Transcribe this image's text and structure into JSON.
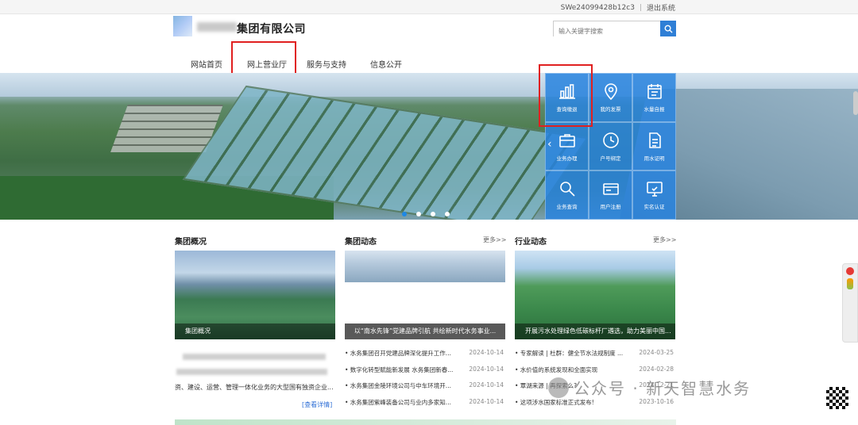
{
  "topbar": {
    "user": "SWe24099428b12c3",
    "separator": "|",
    "logout": "退出系统"
  },
  "header": {
    "company_suffix": "集团有限公司"
  },
  "search": {
    "placeholder": "输入关键字搜索"
  },
  "nav": [
    "网站首页",
    "网上营业厅",
    "服务与支持",
    "信息公开"
  ],
  "tiles": [
    {
      "label": "查询缴退",
      "icon": "bar-chart-icon"
    },
    {
      "label": "我的发票",
      "icon": "location-icon"
    },
    {
      "label": "水量自报",
      "icon": "calendar-icon"
    },
    {
      "label": "业务办理",
      "icon": "briefcase-icon"
    },
    {
      "label": "户号绑定",
      "icon": "clock-icon"
    },
    {
      "label": "用水证明",
      "icon": "document-icon"
    },
    {
      "label": "业务查询",
      "icon": "search-icon"
    },
    {
      "label": "用户注册",
      "icon": "id-card-icon"
    },
    {
      "label": "实名认证",
      "icon": "monitor-icon"
    }
  ],
  "sections": {
    "overview": {
      "title": "集团概况",
      "caption": "集团概况",
      "intro_line": "资、建设、运营、管理一体化业务的大型国有独资企业...",
      "more": "[查看详情]"
    },
    "group_news": {
      "title": "集团动态",
      "more": "更多>>",
      "caption": "以“南水先锋”党建品牌引航 共绘新时代水务事业...",
      "items": [
        {
          "title": "• 水务集团召开党建品牌深化提升工作...",
          "date": "2024-10-14"
        },
        {
          "title": "• 数字化转型赋能新发展 水务集团新春...",
          "date": "2024-10-14"
        },
        {
          "title": "• 水务集团金陵环境公司与中车环境开...",
          "date": "2024-10-14"
        },
        {
          "title": "• 水务集团紫峰装备公司与业内多家知...",
          "date": "2024-10-14"
        }
      ]
    },
    "industry_news": {
      "title": "行业动态",
      "more": "更多>>",
      "caption": "开展污水处理绿色低碳标杆厂遴选，助力美丽中国...",
      "items": [
        {
          "title": "• 专家解读 | 杜群：健全节水法规制度 ...",
          "date": "2024-03-25"
        },
        {
          "title": "• 水价值的系统发现和全面实现",
          "date": "2024-02-28"
        },
        {
          "title": "• 覃湖来源 | 再探索么?",
          "date": "2024-12-21"
        },
        {
          "title": "• 这项涉水国家标准正式发布!",
          "date": "2023-10-16"
        }
      ]
    }
  },
  "watermark": "公众号 · 新天智慧水务",
  "colors": {
    "accent": "#2984de",
    "highlight": "#e02020"
  }
}
